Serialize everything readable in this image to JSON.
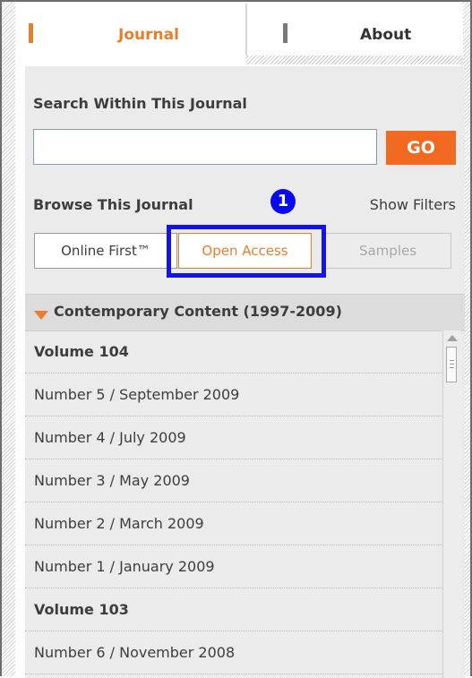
{
  "tabs": {
    "journal": "Journal",
    "about": "About"
  },
  "search": {
    "title": "Search Within This Journal",
    "value": "",
    "go_label": "GO"
  },
  "browse": {
    "title": "Browse This Journal",
    "show_filters": "Show Filters",
    "annotation_number": "1",
    "filters": [
      {
        "label": "Online First™",
        "state": "default"
      },
      {
        "label": "Open Access",
        "state": "selected"
      },
      {
        "label": "Samples",
        "state": "disabled"
      }
    ]
  },
  "content": {
    "header": "Contemporary Content (1997-2009)",
    "items": [
      {
        "label": "Volume 104",
        "type": "volume"
      },
      {
        "label": "Number 5 / September 2009",
        "type": "issue"
      },
      {
        "label": "Number 4 / July 2009",
        "type": "issue"
      },
      {
        "label": "Number 3 / May 2009",
        "type": "issue"
      },
      {
        "label": "Number 2 / March 2009",
        "type": "issue"
      },
      {
        "label": "Number 1 / January 2009",
        "type": "issue"
      },
      {
        "label": "Volume 103",
        "type": "volume"
      },
      {
        "label": "Number 6 / November 2008",
        "type": "issue"
      }
    ]
  },
  "colors": {
    "accent": "#e87d2b",
    "go_button": "#f26a21",
    "highlight": "#1414e6",
    "panel_bg": "#ebebeb"
  },
  "icons": {
    "expand": "triangle-down-icon",
    "scroll_up": "arrow-up-icon"
  }
}
